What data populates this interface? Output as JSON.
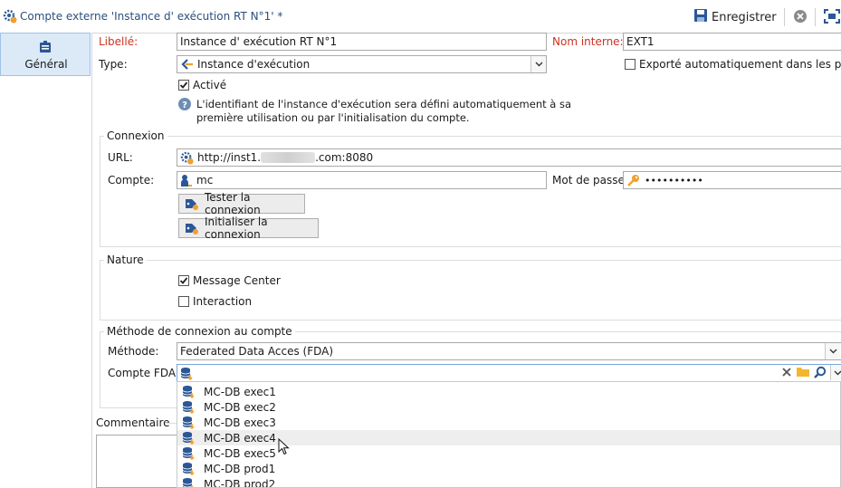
{
  "window": {
    "title": "Compte externe 'Instance d' exécution RT N°1' *",
    "save_label": "Enregistrer"
  },
  "sidebar": {
    "tabs": [
      {
        "label": "Général"
      }
    ]
  },
  "form": {
    "libelle_label": "Libellé:",
    "libelle_value": "Instance d' exécution RT N°1",
    "nom_interne_label": "Nom interne:",
    "nom_interne_value": "EXT1",
    "type_label": "Type:",
    "type_value": "Instance d'exécution",
    "exporte_label": "Exporté automatiquement dans les packag",
    "active_label": "Activé",
    "info_text_line1": "L'identifiant de l'instance d'exécution sera défini automatiquement à sa",
    "info_text_line2": "première utilisation ou par l'initialisation du compte."
  },
  "connexion": {
    "group_label": "Connexion",
    "url_label": "URL:",
    "url_prefix": "http://inst1.",
    "url_suffix": ".com:8080",
    "compte_label": "Compte:",
    "compte_value": "mc",
    "password_label": "Mot de passe:",
    "password_value": "••••••••••",
    "test_button": "Tester la connexion",
    "init_button": "Initialiser la connexion"
  },
  "nature": {
    "group_label": "Nature",
    "message_center_label": "Message Center",
    "interaction_label": "Interaction"
  },
  "methode": {
    "group_label": "Méthode de connexion au compte",
    "methode_label": "Méthode:",
    "methode_value": "Federated Data Acces (FDA)",
    "compte_fda_label": "Compte FDA:"
  },
  "commentaire": {
    "label": "Commentaire"
  },
  "fda_options": [
    "MC-DB exec1",
    "MC-DB exec2",
    "MC-DB exec3",
    "MC-DB exec4",
    "MC-DB exec5",
    "MC-DB prod1",
    "MC-DB prod2"
  ]
}
